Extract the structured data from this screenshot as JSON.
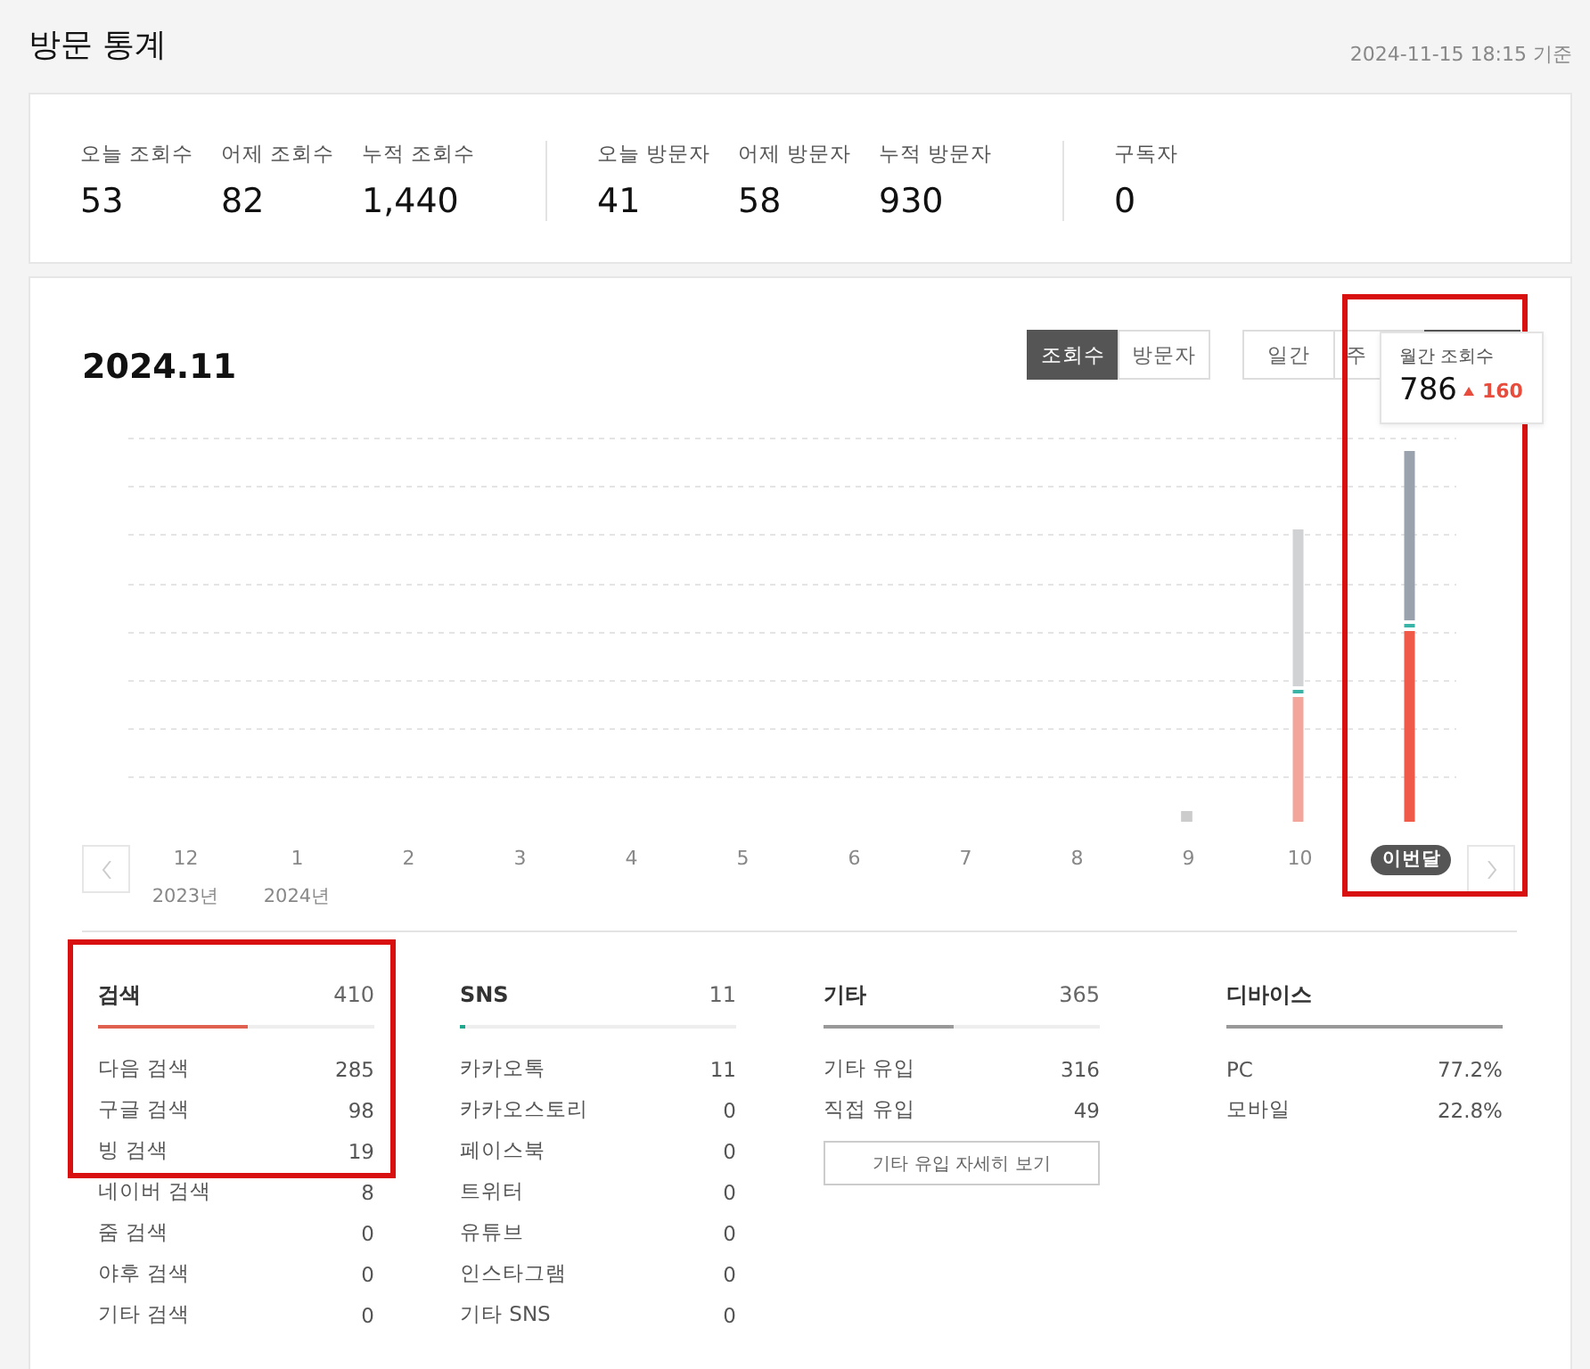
{
  "page": {
    "title": "방문 통계",
    "updated": "2024-11-15 18:15 기준"
  },
  "summary": [
    {
      "items": [
        {
          "label": "오늘 조회수",
          "value": "53"
        },
        {
          "label": "어제 조회수",
          "value": "82"
        },
        {
          "label": "누적 조회수",
          "value": "1,440"
        }
      ]
    },
    {
      "items": [
        {
          "label": "오늘 방문자",
          "value": "41"
        },
        {
          "label": "어제 방문자",
          "value": "58"
        },
        {
          "label": "누적 방문자",
          "value": "930"
        }
      ]
    },
    {
      "items": [
        {
          "label": "구독자",
          "value": "0"
        }
      ]
    }
  ],
  "chart": {
    "period": "2024.11",
    "current_highlighted": true,
    "metric_tabs": [
      {
        "label": "조회수",
        "selected": true
      },
      {
        "label": "방문자",
        "selected": false
      }
    ],
    "period_tabs": [
      {
        "label": "일간",
        "selected": false
      },
      {
        "label": "주",
        "selected": false
      },
      {
        "selected": true
      }
    ],
    "tooltip": {
      "title": "월간 조회수",
      "value": "786",
      "change": "160"
    },
    "months": [
      {
        "label": "12",
        "year": "2023년",
        "current": false
      },
      {
        "label": "1",
        "year": "2024년",
        "current": false
      },
      {
        "label": "2",
        "current": false
      },
      {
        "label": "3",
        "current": false
      },
      {
        "label": "4",
        "current": false
      },
      {
        "label": "5",
        "current": false
      },
      {
        "label": "6",
        "current": false
      },
      {
        "label": "7",
        "current": false
      },
      {
        "label": "8",
        "current": false
      },
      {
        "label": "9",
        "current": false
      },
      {
        "label": "10",
        "current": false
      },
      {
        "label": "이번달",
        "current": true
      }
    ]
  },
  "sources": [
    {
      "title": "검색",
      "total": "410",
      "level": 0.54,
      "color": "#e0604f",
      "highlighted": true,
      "framed_items": [
        {
          "label": "다음 검색",
          "value": "285"
        },
        {
          "label": "구글 검색",
          "value": "98"
        },
        {
          "label": "빙 검색",
          "value": "19"
        }
      ],
      "items": [
        {
          "label": "네이버 검색",
          "value": "8"
        },
        {
          "label": "줌 검색",
          "value": "0"
        },
        {
          "label": "야후 검색",
          "value": "0"
        },
        {
          "label": "기타 검색",
          "value": "0"
        }
      ]
    },
    {
      "title": "SNS",
      "total": "11",
      "level": 0.02,
      "color": "#1fa88f",
      "highlighted": false,
      "items": [
        {
          "label": "카카오톡",
          "value": "11"
        },
        {
          "label": "카카오스토리",
          "value": "0"
        },
        {
          "label": "페이스북",
          "value": "0"
        },
        {
          "label": "트위터",
          "value": "0"
        },
        {
          "label": "유튜브",
          "value": "0"
        },
        {
          "label": "인스타그램",
          "value": "0"
        },
        {
          "label": "기타 SNS",
          "value": "0"
        }
      ]
    },
    {
      "title": "기타",
      "total": "365",
      "level": 0.47,
      "color": "#999999",
      "highlighted": false,
      "button": "기타 유입 자세히 보기",
      "items": [
        {
          "label": "기타 유입",
          "value": "316"
        },
        {
          "label": "직접 유입",
          "value": "49"
        }
      ]
    },
    {
      "title": "디바이스",
      "level": 1,
      "color": "#999999",
      "highlighted": false,
      "items": [
        {
          "label": "PC",
          "value": "77.2%"
        },
        {
          "label": "모바일",
          "value": "22.8%"
        }
      ]
    }
  ]
}
